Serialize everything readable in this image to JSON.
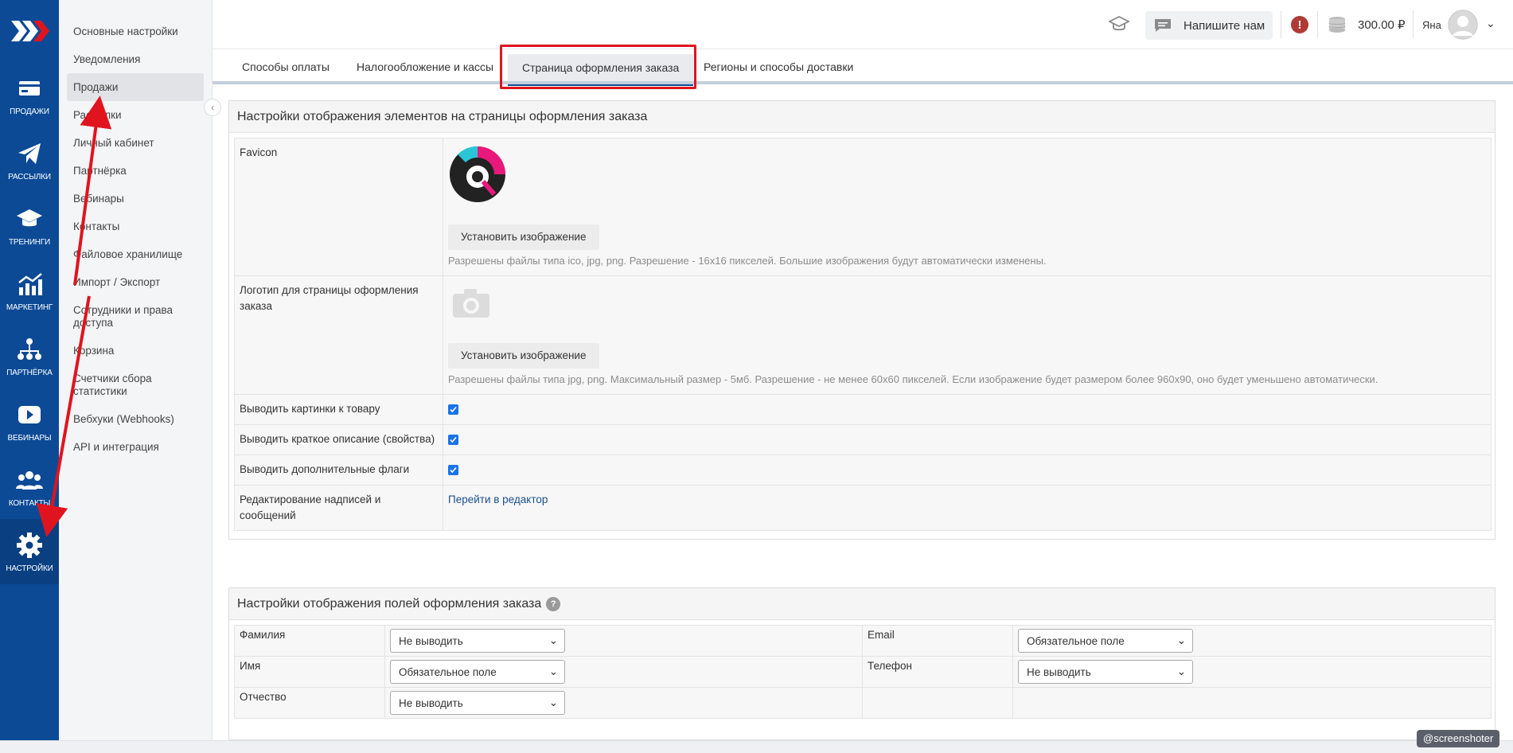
{
  "rail": {
    "items": [
      {
        "label": "ПРОДАЖИ",
        "icon": "card-icon"
      },
      {
        "label": "РАССЫЛКИ",
        "icon": "paper-plane-icon"
      },
      {
        "label": "ТРЕНИНГИ",
        "icon": "graduation-cap-icon"
      },
      {
        "label": "МАРКЕТИНГ",
        "icon": "chart-icon"
      },
      {
        "label": "ПАРТНЁРКА",
        "icon": "org-tree-icon"
      },
      {
        "label": "ВЕБИНАРЫ",
        "icon": "play-icon"
      },
      {
        "label": "КОНТАКТЫ",
        "icon": "users-icon"
      },
      {
        "label": "НАСТРОЙКИ",
        "icon": "gear-icon"
      }
    ]
  },
  "submenu": {
    "items": [
      {
        "label": "Основные настройки"
      },
      {
        "label": "Уведомления"
      },
      {
        "label": "Продажи"
      },
      {
        "label": "Рассылки"
      },
      {
        "label": "Личный кабинет"
      },
      {
        "label": "Партнёрка"
      },
      {
        "label": "Вебинары"
      },
      {
        "label": "Контакты"
      },
      {
        "label": "Файловое хранилище"
      },
      {
        "label": "Импорт / Экспорт"
      },
      {
        "label": "Сотрудники и права доступа"
      },
      {
        "label": "Корзина"
      },
      {
        "label": "Счетчики сбора статистики"
      },
      {
        "label": "Вебхуки (Webhooks)"
      },
      {
        "label": "API и интеграция"
      }
    ]
  },
  "topbar": {
    "write_label": "Напишите нам",
    "alert": "!",
    "balance": "300.00 ₽",
    "user": "Яна"
  },
  "tabs": [
    {
      "label": "Способы оплаты"
    },
    {
      "label": "Налогообложение и кассы"
    },
    {
      "label": "Страница оформления заказа"
    },
    {
      "label": "Регионы и способы доставки"
    }
  ],
  "display_panel": {
    "title": "Настройки отображения элементов на страницы оформления заказа",
    "favicon_label": "Favicon",
    "set_image": "Установить изображение",
    "favicon_hint": "Разрешены файлы типа ico, jpg, png. Разрешение - 16x16 пикселей. Большие изображения будут автоматически изменены.",
    "logo_label": "Логотип для страницы оформления заказа",
    "logo_hint": "Разрешены файлы типа jpg, png. Максимальный размер - 5мб. Разрешение - не менее 60x60 пикселей. Если изображение будет размером более 960x90, оно будет уменьшено автоматически.",
    "show_images": "Выводить картинки к товару",
    "show_short_desc": "Выводить краткое описание (свойства)",
    "show_flags": "Выводить дополнительные флаги",
    "edit_labels": "Редактирование надписей и сообщений",
    "editor_link": "Перейти в редактор"
  },
  "fields_panel": {
    "title": "Настройки отображения полей оформления заказа",
    "rows": [
      {
        "l1": "Фамилия",
        "v1": "Не выводить",
        "l2": "Email",
        "v2": "Обязательное поле"
      },
      {
        "l1": "Имя",
        "v1": "Обязательное поле",
        "l2": "Телефон",
        "v2": "Не выводить"
      },
      {
        "l1": "Отчество",
        "v1": "Не выводить",
        "l2": "",
        "v2": ""
      }
    ]
  },
  "watermark": "@screenshoter",
  "colors": {
    "rail": "#0c4a96",
    "highlight": "#e0141e",
    "annotation_arrow": "#e0141e"
  }
}
